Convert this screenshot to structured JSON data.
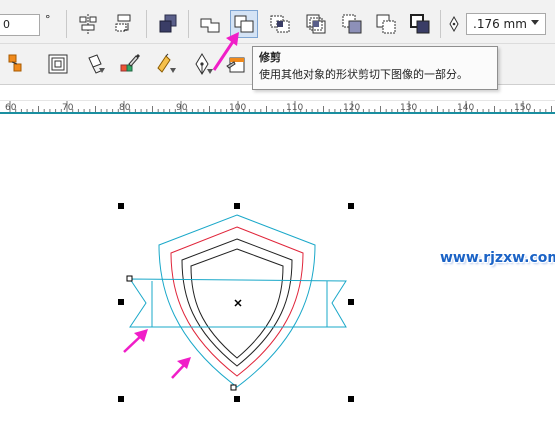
{
  "toolbar": {
    "angle_value": "0",
    "angle_unit": "°",
    "outline_width": ".176 mm",
    "tools_row1": [
      "align-distribute-icon",
      "convert-icon",
      "group-icon",
      "weld-icon",
      "trim-icon",
      "intersect-icon",
      "simplify-icon",
      "front-minus-back-icon",
      "back-minus-front-icon",
      "boundary-icon",
      "pen-outline-icon"
    ],
    "tools_row2": [
      "smart-fill-icon",
      "contour-icon",
      "fill-bucket-icon",
      "eyedropper-icon",
      "interactive-fill-icon",
      "pen-nib-icon",
      "edit-fill-icon"
    ],
    "active_tool": "trim"
  },
  "tooltip": {
    "title": "修剪",
    "body": "使用其他对象的形状剪切下图像的一部分。"
  },
  "ruler": {
    "labels": [
      "60",
      "70",
      "80",
      "90",
      "100",
      "110",
      "120",
      "130",
      "140",
      "150"
    ]
  },
  "canvas": {
    "shield_outer_color": "#1aa8c9",
    "shield_red_color": "#e0253a",
    "shield_inner_color": "#222222",
    "ribbon_color": "#1aa8c9",
    "arrow_color": "#f01ec8",
    "watermark": "www.rjzxw.com"
  }
}
